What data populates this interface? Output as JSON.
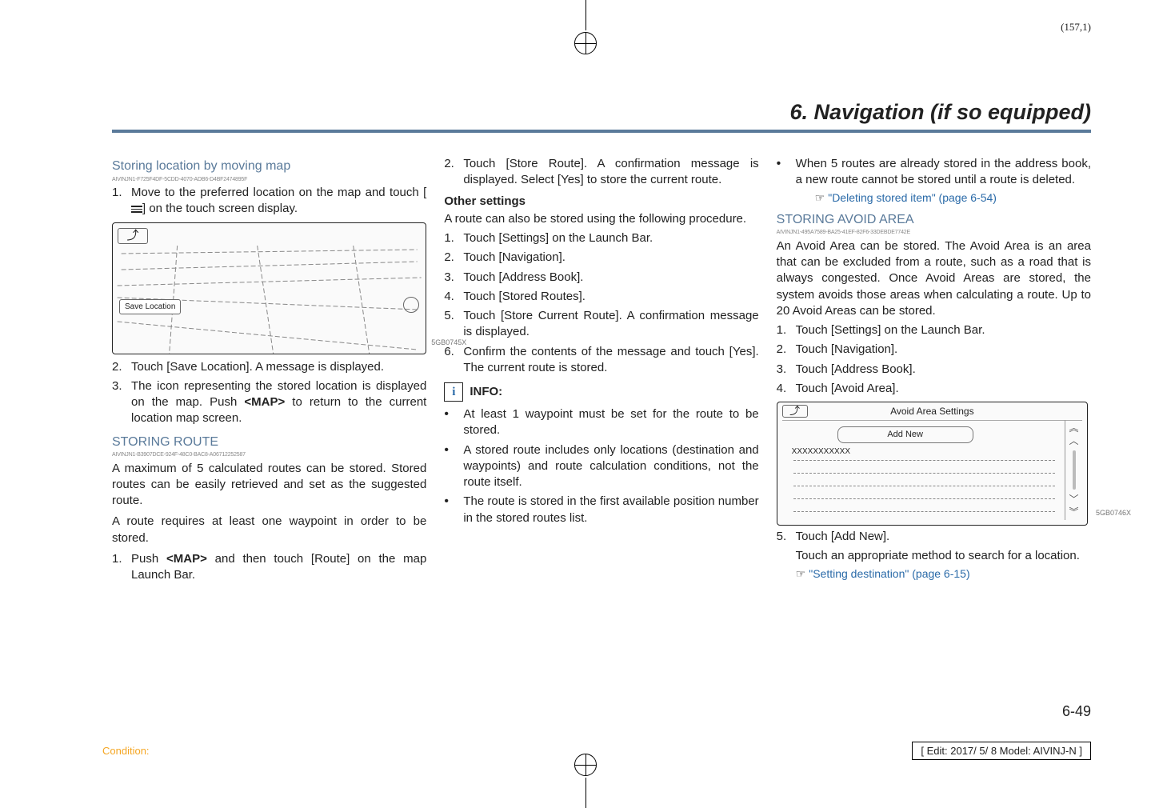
{
  "page_num_top": "(157,1)",
  "chapter_title": "6. Navigation (if so equipped)",
  "col1": {
    "h1": "Storing location by moving map",
    "guid1": "AIVINJN1-F725F4DF-5CDD-4070-ADB6-D4BF2474895F",
    "step1": "Move to the preferred location on the map and touch [",
    "step1b": "] on the touch screen display.",
    "map_back": "⤴",
    "map_save": "Save Location",
    "figcode1": "5GB0745X",
    "step2": "Touch [Save Location]. A message is displayed.",
    "step3": "The icon representing the stored location is displayed on the map. Push <MAP> to return to the current location map screen.",
    "h2": "STORING ROUTE",
    "guid2": "AIVINJN1-B3907DCE-924F-48C0-BAC8-A06712252587",
    "p1": "A maximum of 5 calculated routes can be stored. Stored routes can be easily retrieved and set as the suggested route.",
    "p2": "A route requires at least one waypoint in order to be stored.",
    "step_b1": "Push <MAP> and then touch [Route] on the map Launch Bar."
  },
  "col2": {
    "step_b2": "Touch [Store Route]. A confirmation message is displayed. Select [Yes] to store the current route.",
    "h_other": "Other settings",
    "p_other": "A route can also be stored using the following procedure.",
    "s1": "Touch [Settings] on the Launch Bar.",
    "s2": "Touch [Navigation].",
    "s3": "Touch [Address Book].",
    "s4": "Touch [Stored Routes].",
    "s5": "Touch [Store Current Route]. A confirmation message is displayed.",
    "s6": "Confirm the contents of the message and touch [Yes]. The current route is stored.",
    "info_label": "INFO:",
    "b1": "At least 1 waypoint must be set for the route to be stored.",
    "b2": "A stored route includes only locations (destination and waypoints) and route calculation conditions, not the route itself.",
    "b3": "The route is stored in the first available position number in the stored routes list."
  },
  "col3": {
    "b4": "When 5 routes are already stored in the address book, a new route cannot be stored until a route is deleted.",
    "xref1": "\"Deleting stored item\" (page 6-54)",
    "h3": "STORING AVOID AREA",
    "guid3": "AIVINJN1-495A7589-BA25-41EF-82F6-33DEBDE7742E",
    "p3": "An Avoid Area can be stored. The Avoid Area is an area that can be excluded from a route, such as a road that is always congested. Once Avoid Areas are stored, the system avoids those areas when calculating a route. Up to 20 Avoid Areas can be stored.",
    "a1": "Touch [Settings] on the Launch Bar.",
    "a2": "Touch [Navigation].",
    "a3": "Touch [Address Book].",
    "a4": "Touch [Avoid Area].",
    "screen_title": "Avoid Area Settings",
    "screen_btn": "Add New",
    "screen_row": "XXXXXXXXXXX",
    "figcode2": "5GB0746X",
    "a5": "Touch [Add New].",
    "a5p": "Touch an appropriate method to search for a location.",
    "xref2": "\"Setting destination\" (page 6-15)"
  },
  "page_num_bottom": "6-49",
  "condition": "Condition:",
  "edit_box": "[ Edit: 2017/ 5/ 8   Model: AIVINJ-N ]"
}
